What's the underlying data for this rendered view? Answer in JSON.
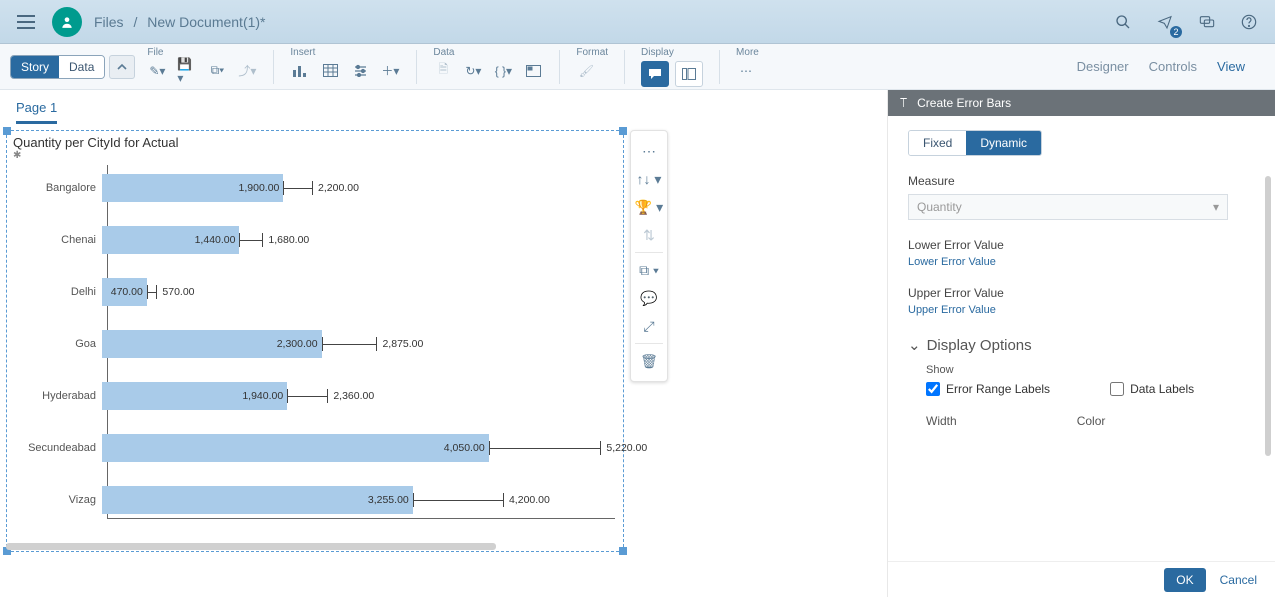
{
  "breadcrumb": {
    "root": "Files",
    "current": "New Document(1)*"
  },
  "notifBadge": "2",
  "viewToggle": {
    "story": "Story",
    "data": "Data"
  },
  "toolbarGroups": {
    "file": "File",
    "insert": "Insert",
    "data": "Data",
    "format": "Format",
    "display": "Display",
    "more": "More"
  },
  "rightLinks": {
    "designer": "Designer",
    "controls": "Controls",
    "view": "View"
  },
  "pageTab": "Page 1",
  "chart_data": {
    "type": "bar",
    "title": "Quantity per CityId for Actual",
    "categories": [
      "Bangalore",
      "Chenai",
      "Delhi",
      "Goa",
      "Hyderabad",
      "Secundeabad",
      "Vizag"
    ],
    "values": [
      1900.0,
      1440.0,
      470.0,
      2300.0,
      1940.0,
      4050.0,
      3255.0
    ],
    "upper_error": [
      2200.0,
      1680.0,
      570.0,
      2875.0,
      2360.0,
      5220.0,
      4200.0
    ],
    "value_labels": [
      "1,900.00",
      "1,440.00",
      "470.00",
      "2,300.00",
      "1,940.00",
      "4,050.00",
      "3,255.00"
    ],
    "upper_labels": [
      "2,200.00",
      "1,680.00",
      "570.00",
      "2,875.00",
      "2,360.00",
      "5,220.00",
      "4,200.00"
    ],
    "xlim": [
      0,
      5300
    ]
  },
  "panel": {
    "title": "Create Error Bars",
    "tabFixed": "Fixed",
    "tabDynamic": "Dynamic",
    "measureLabel": "Measure",
    "measureValue": "Quantity",
    "lowerLabel": "Lower Error Value",
    "lowerLink": "Lower Error Value",
    "upperLabel": "Upper Error Value",
    "upperLink": "Upper Error Value",
    "displayOptions": "Display Options",
    "show": "Show",
    "errRangeLabels": "Error Range Labels",
    "dataLabels": "Data Labels",
    "width": "Width",
    "color": "Color",
    "ok": "OK",
    "cancel": "Cancel"
  }
}
